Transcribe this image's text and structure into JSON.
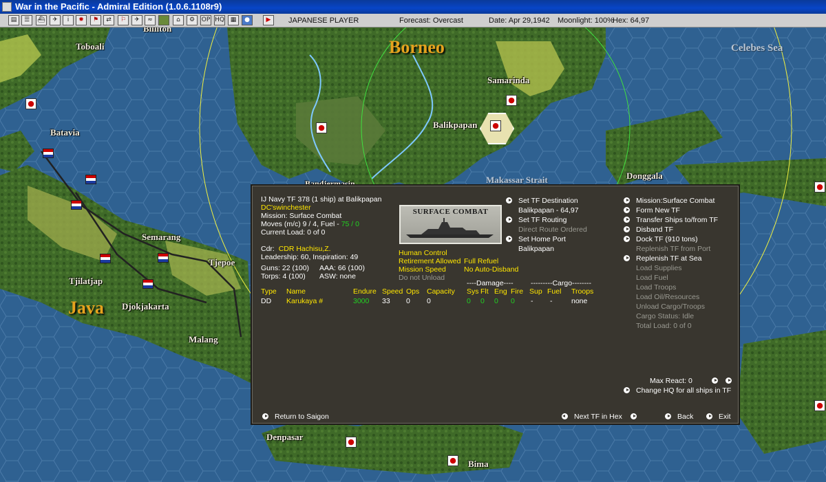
{
  "window": {
    "title": "War in the Pacific - Admiral Edition (1.0.6.1108r9)"
  },
  "toolbar": {
    "buttons": [
      "report-icon",
      "list-icon",
      "ship-icon",
      "plane-icon",
      "info-icon",
      "rising-sun-icon",
      "flag-icon",
      "swap-icon",
      "red-flag-icon",
      "plane-small-icon",
      "ship-small-icon",
      "map-icon",
      "group-icon",
      "op-icon",
      "hq-icon",
      "globe-icon",
      "end-turn-icon"
    ],
    "op_label": "OP",
    "hq_label": "HQ",
    "player": "JAPANESE PLAYER",
    "forecast": "Forecast: Overcast",
    "date": "Date: Apr 29,1942",
    "moonlight": "Moonlight: 100%",
    "hex": "Hex: 64,97"
  },
  "map": {
    "labels": [
      {
        "text": "Billiton",
        "cls": ""
      },
      {
        "text": "Toboali",
        "cls": ""
      },
      {
        "text": "Borneo",
        "cls": "big"
      },
      {
        "text": "Celebes Sea",
        "cls": "sea"
      },
      {
        "text": "Samarinda",
        "cls": ""
      },
      {
        "text": "Balikpapan",
        "cls": ""
      },
      {
        "text": "Batavia",
        "cls": ""
      },
      {
        "text": "Donggala",
        "cls": ""
      },
      {
        "text": "Bandjermasin",
        "cls": ""
      },
      {
        "text": "Makassar Strait",
        "cls": "sea"
      },
      {
        "text": "Java",
        "cls": "big"
      },
      {
        "text": "Semarang",
        "cls": ""
      },
      {
        "text": "Tjepoe",
        "cls": ""
      },
      {
        "text": "Tjilatjap",
        "cls": ""
      },
      {
        "text": "Djokjakarta",
        "cls": ""
      },
      {
        "text": "Malang",
        "cls": ""
      },
      {
        "text": "Denpasar",
        "cls": ""
      },
      {
        "text": "Bima",
        "cls": ""
      }
    ]
  },
  "tf": {
    "header": "IJ Navy TF 378 (1 ship) at Balikpapan",
    "player_name": "DC'swinchester",
    "mission": "Mission: Surface Combat",
    "moves": "Moves (m/c) 9 / 4, Fuel - ",
    "fuel": "75 / 0",
    "current_load": "Current Load: 0 of 0",
    "cdr_label": "Cdr:",
    "cdr_name": "CDR Hachisu,Z.",
    "leadership": "Leadership: 60, Inspiration: 49",
    "guns": "Guns: 22 (100)",
    "aaa": "AAA: 66 (100)",
    "torps": "Torps: 4 (100)",
    "asw": "ASW: none",
    "mission_image_caption": "SURFACE COMBAT",
    "control": "Human Control",
    "retirement": "Retirement Allowed",
    "refuel": "Full Refuel",
    "mission_speed": "Mission Speed",
    "auto_disband": "No Auto-Disband",
    "unload": "Do not Unload",
    "table": {
      "damage_header": "----Damage----",
      "cargo_header": "---------Cargo--------",
      "columns": [
        "Type",
        "Name",
        "Endure",
        "Speed",
        "Ops",
        "Capacity",
        "Sys",
        "Flt",
        "Eng",
        "Fire",
        "Sup",
        "Fuel",
        "Troops"
      ],
      "rows": [
        {
          "type": "DD",
          "name": "Karukaya #",
          "endure": "3000",
          "speed": "33",
          "ops": "0",
          "capacity": "0",
          "sys": "0",
          "flt": "0",
          "eng": "0",
          "fire": "0",
          "sup": "-",
          "fuel": "-",
          "troops": "none"
        }
      ]
    },
    "mid_menu": {
      "set_dest": "Set TF Destination",
      "dest_value": "Balikpapan - 64,97",
      "set_routing": "Set TF Routing",
      "routing_value": "Direct Route Ordered",
      "set_home": "Set Home Port",
      "home_value": "Balikpapan"
    },
    "right_menu": {
      "mission": "Mission:Surface Combat",
      "form_new": "Form New TF",
      "transfer": "Transfer Ships to/from TF",
      "disband": "Disband TF",
      "dock": "Dock TF (910 tons)",
      "replenish_port": "Replenish TF from Port",
      "replenish_sea": "Replenish TF at Sea",
      "load_supplies": "Load Supplies",
      "load_fuel": "Load Fuel",
      "load_troops": "Load Troops",
      "load_oil": "Load Oil/Resources",
      "unload_cargo": "Unload Cargo/Troops",
      "cargo_status": "Cargo Status: Idle",
      "total_load": "Total Load: 0 of 0",
      "max_react": "Max React:  0",
      "change_hq": "Change HQ for all ships in TF"
    },
    "bottom": {
      "return": "Return to Saigon",
      "next_tf": "Next TF in Hex",
      "back": "Back",
      "exit": "Exit"
    }
  },
  "colors": {
    "panel_bg": "#39362f",
    "highlight_yellow": "#ffe600",
    "value_green": "#22d022",
    "disabled_gray": "#9a9a92",
    "sea": "#2e5d8c"
  }
}
